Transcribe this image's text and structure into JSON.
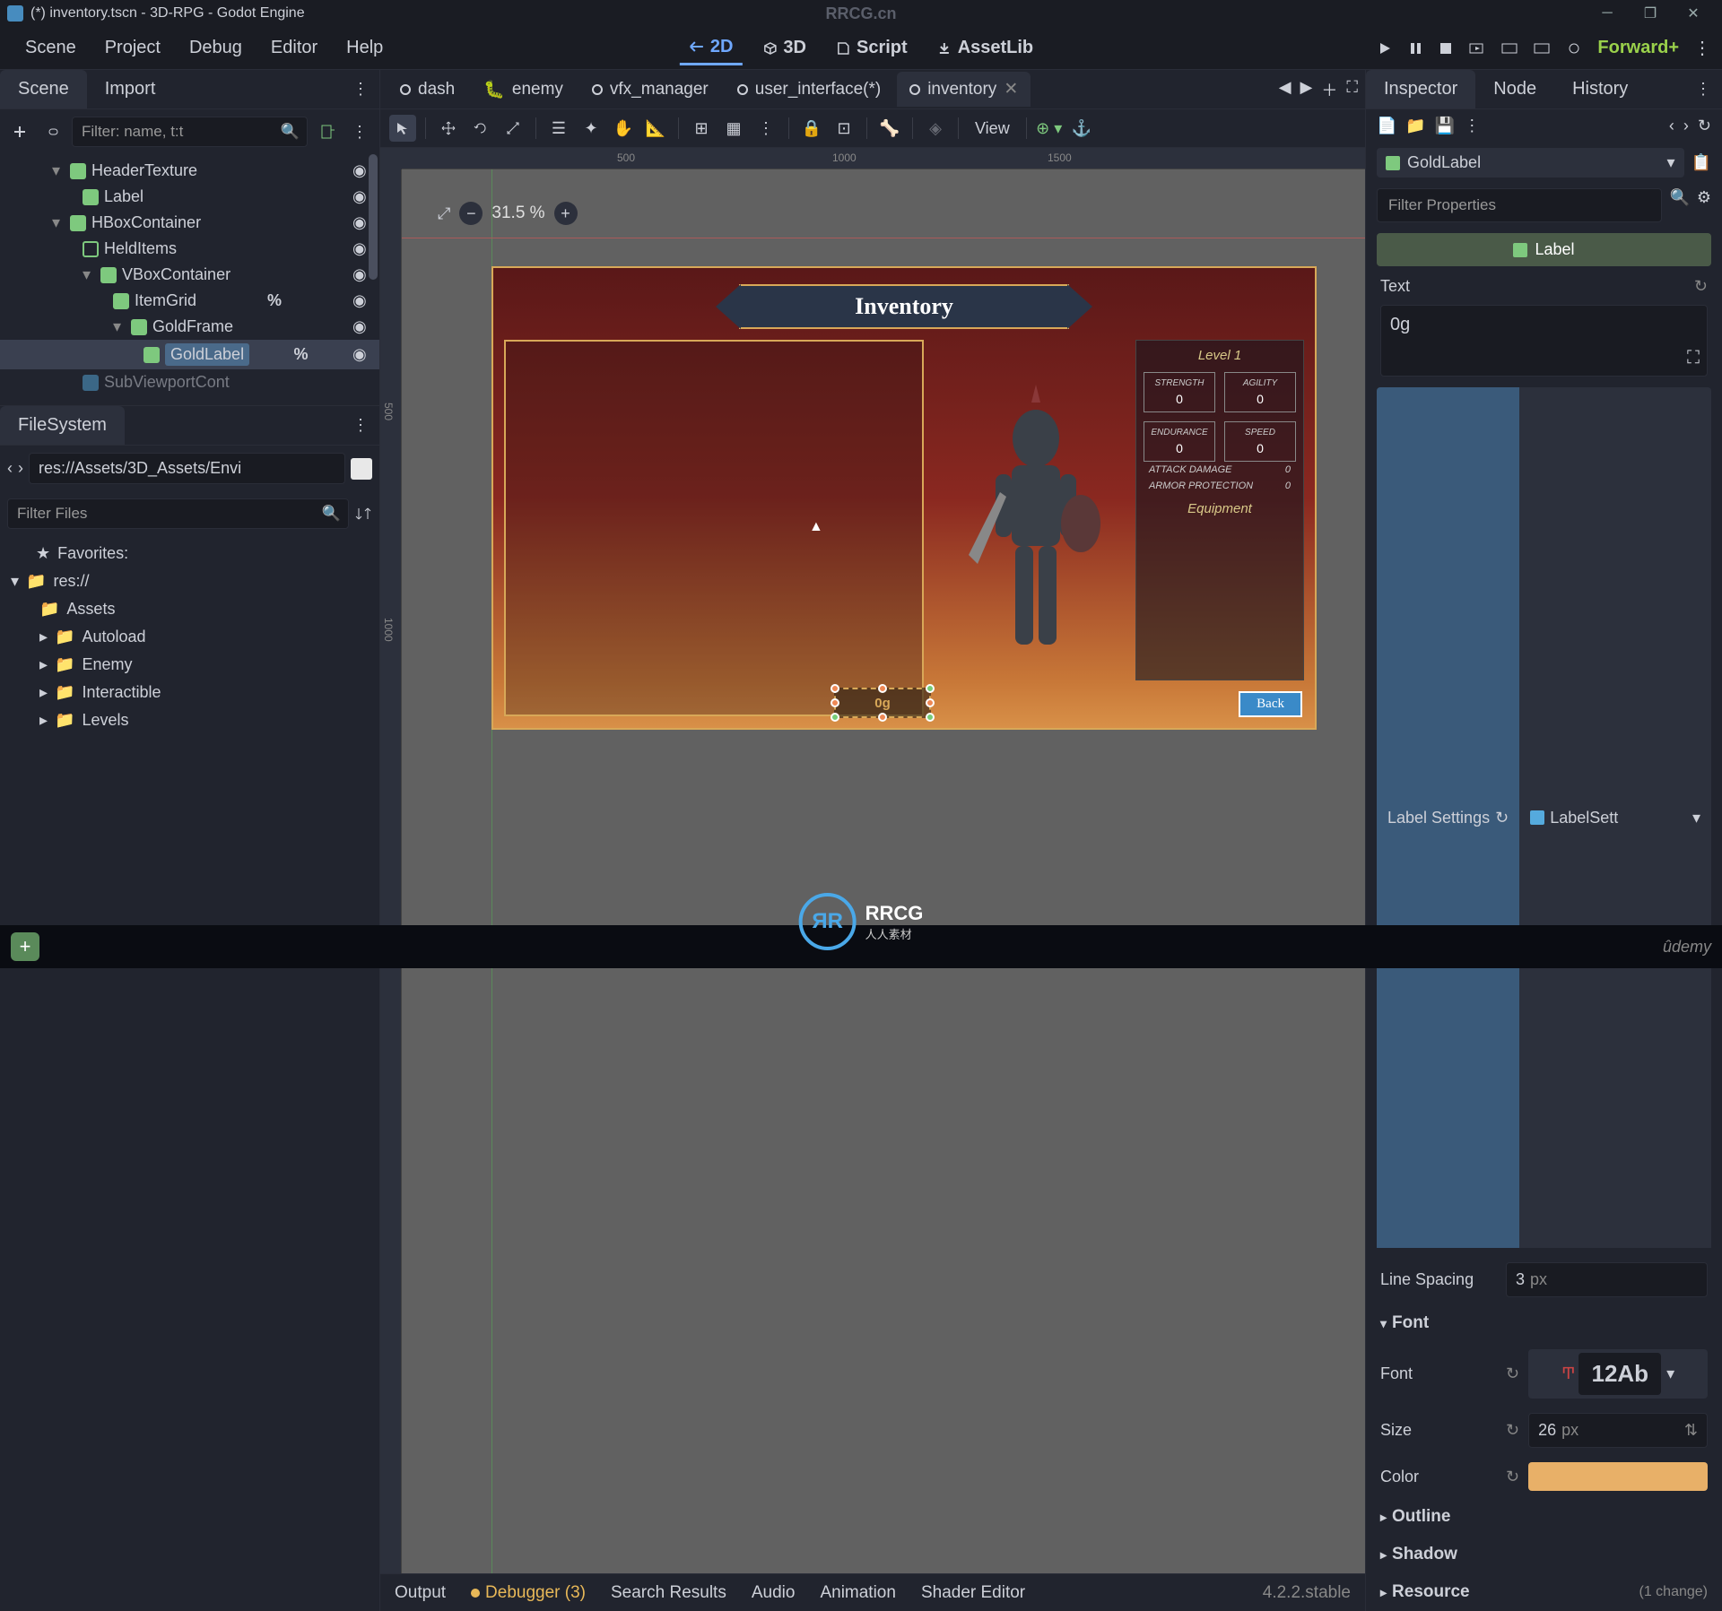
{
  "title": "(*) inventory.tscn - 3D-RPG - Godot Engine",
  "watermark_top": "RRCG.cn",
  "menu": {
    "scene": "Scene",
    "project": "Project",
    "debug": "Debug",
    "editor": "Editor",
    "help": "Help"
  },
  "workspace": {
    "wp_2d": "2D",
    "wp_3d": "3D",
    "wp_script": "Script",
    "wp_assetlib": "AssetLib"
  },
  "render_mode": "Forward+",
  "left_tabs": {
    "scene": "Scene",
    "import": "Import"
  },
  "scene_filter_placeholder": "Filter: name, t:t",
  "scene_tree": {
    "n0": "HeaderTexture",
    "n1": "Label",
    "n2": "HBoxContainer",
    "n3": "HeldItems",
    "n4": "VBoxContainer",
    "n5": "ItemGrid",
    "n6": "GoldFrame",
    "n7": "GoldLabel",
    "n8": "SubViewportCont"
  },
  "fs": {
    "title": "FileSystem",
    "path": "res://Assets/3D_Assets/Envi",
    "filter_placeholder": "Filter Files",
    "fav": "Favorites:",
    "root": "res://",
    "f0": "Assets",
    "f1": "Autoload",
    "f2": "Enemy",
    "f3": "Interactible",
    "f4": "Levels"
  },
  "scene_tabs": {
    "t0": "dash",
    "t1": "enemy",
    "t2": "vfx_manager",
    "t3": "user_interface(*)",
    "t4": "inventory"
  },
  "viewport": {
    "zoom": "31.5 %",
    "view_label": "View",
    "ruler_500": "500",
    "ruler_1000": "1000",
    "ruler_1500": "1500",
    "ruler_v500": "500",
    "ruler_v1000": "1000"
  },
  "game": {
    "title": "Inventory",
    "level": "Level 1",
    "stats": {
      "s0_name": "STRENGTH",
      "s0_val": "0",
      "s1_name": "AGILITY",
      "s1_val": "0",
      "s2_name": "ENDURANCE",
      "s2_val": "0",
      "s3_name": "SPEED",
      "s3_val": "0"
    },
    "atk_label": "ATTACK DAMAGE",
    "atk_val": "0",
    "armor_label": "ARMOR PROTECTION",
    "armor_val": "0",
    "equipment": "Equipment",
    "back": "Back",
    "gold": "0g"
  },
  "inspector": {
    "tabs": {
      "insp": "Inspector",
      "node": "Node",
      "history": "History"
    },
    "node_name": "GoldLabel",
    "filter_placeholder": "Filter Properties",
    "section_label": "Label",
    "text_label": "Text",
    "text_value": "0g",
    "label_settings_hdr": "Label Settings",
    "label_settings_res": "LabelSett",
    "line_spacing_label": "Line Spacing",
    "line_spacing_val": "3",
    "line_spacing_unit": "px",
    "font_hdr": "Font",
    "font_label": "Font",
    "font_preview": "12Ab",
    "size_label": "Size",
    "size_val": "26",
    "size_unit": "px",
    "color_label": "Color",
    "outline_hdr": "Outline",
    "shadow_hdr": "Shadow",
    "resource_hdr": "Resource",
    "resource_changes": "(1 change)"
  },
  "bottom": {
    "output": "Output",
    "debugger": "Debugger (3)",
    "search": "Search Results",
    "audio": "Audio",
    "animation": "Animation",
    "shader": "Shader Editor",
    "version": "4.2.2.stable"
  },
  "rrcg": {
    "main": "RRCG",
    "sub": "人人素材"
  },
  "udemy": "ûdemy"
}
